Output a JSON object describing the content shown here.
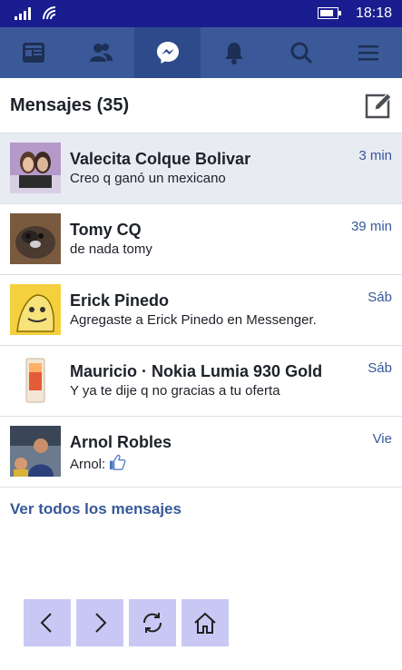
{
  "status": {
    "time": "18:18",
    "icons": [
      "signal-icon",
      "wifi-icon",
      "battery-icon"
    ]
  },
  "nav": {
    "tabs": [
      "news-feed-icon",
      "friends-icon",
      "messenger-icon",
      "notifications-icon",
      "search-icon",
      "menu-icon"
    ],
    "active": "messenger-icon"
  },
  "header": {
    "title": "Mensajes (35)",
    "compose_icon": "compose-icon"
  },
  "messages": [
    {
      "name": "Valecita Colque Bolivar",
      "preview": "Creo q ganó un mexicano",
      "time": "3 min",
      "unread": true
    },
    {
      "name": "Tomy CQ",
      "preview": "de nada tomy",
      "time": "39 min",
      "unread": false
    },
    {
      "name": "Erick Pinedo",
      "preview": "Agregaste a Erick Pinedo en Messenger.",
      "time": "Sáb",
      "unread": false
    },
    {
      "name": "Mauricio · Nokia Lumia 930 Gold",
      "preview": "Y ya te dije q no gracias a tu oferta",
      "time": "Sáb",
      "unread": false
    },
    {
      "name": "Arnol Robles",
      "preview": "Arnol:",
      "time": "Vie",
      "unread": false
    }
  ],
  "see_all": "Ver todos los mensajes",
  "bottom_buttons": [
    "back-icon",
    "forward-icon",
    "refresh-icon",
    "home-icon"
  ],
  "colors": {
    "status_bar": "#1a1d8f",
    "nav_bar": "#3b5998",
    "nav_active": "#2d4b8a",
    "link": "#365899",
    "unread_bg": "#e9ebf3",
    "button_bg": "#c9c8f5"
  }
}
